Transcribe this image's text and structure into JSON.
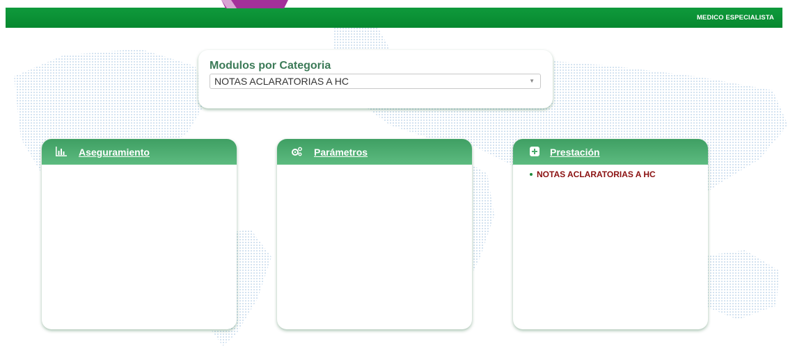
{
  "header": {
    "role_label": "MEDICO ESPECIALISTA",
    "bar_color": "#0f9a3c"
  },
  "module_selector": {
    "title": "Modulos por Categoria",
    "selected_value": "NOTAS ACLARATORIAS A HC"
  },
  "cards": [
    {
      "title": "Aseguramiento",
      "icon": "bar-chart-icon",
      "items": []
    },
    {
      "title": "Parámetros",
      "icon": "gears-icon",
      "items": []
    },
    {
      "title": "Prestación",
      "icon": "plus-square-icon",
      "items": [
        "NOTAS ACLARATORIAS A HC"
      ]
    }
  ],
  "colors": {
    "card_header": "#4aab6c",
    "title_text": "#3b7a57",
    "item_text": "#8a1010"
  }
}
